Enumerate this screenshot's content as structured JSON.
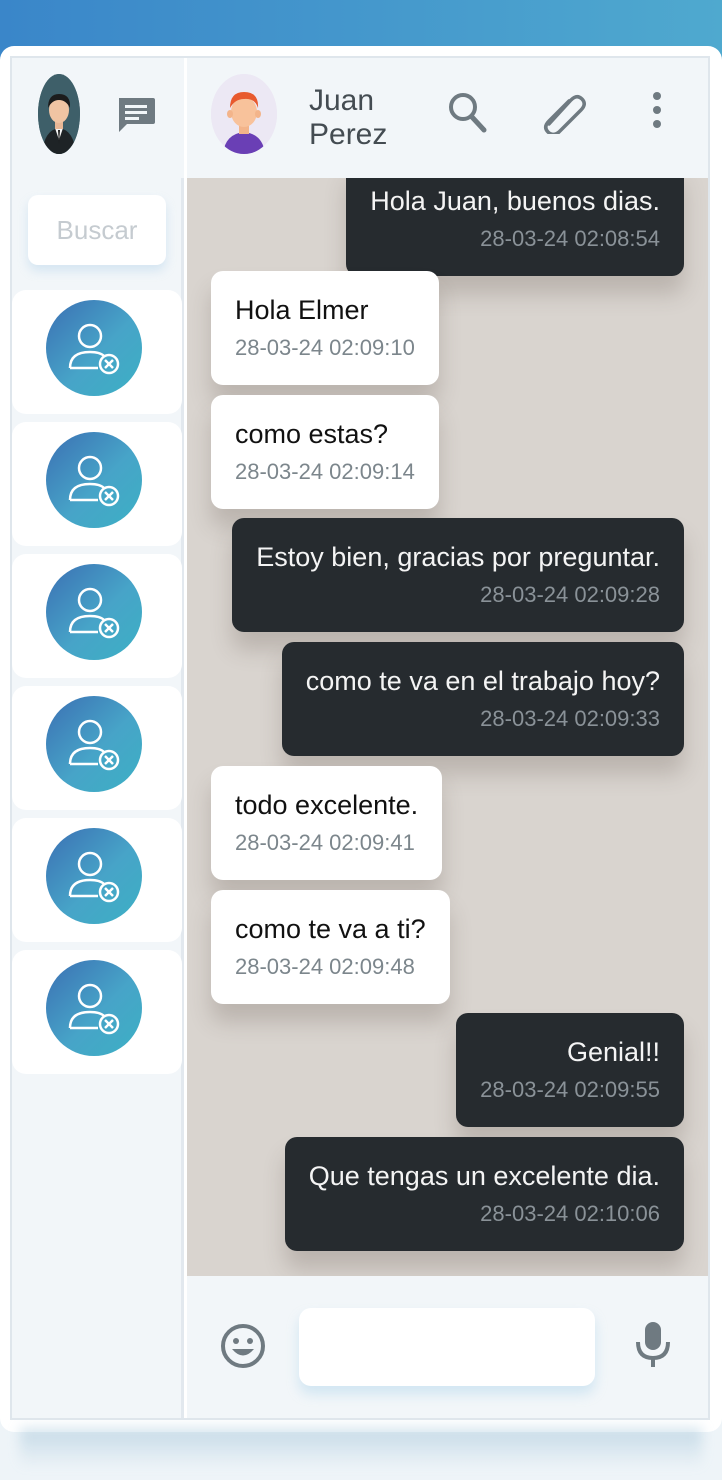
{
  "sidebar": {
    "search_placeholder": "Buscar",
    "icons": {
      "profile": "user-avatar",
      "new_chat": "chat-bubble-icon",
      "contact": "user-removed-icon"
    },
    "contacts": [
      {
        "avatar": "user-removed-icon"
      },
      {
        "avatar": "user-removed-icon"
      },
      {
        "avatar": "user-removed-icon"
      },
      {
        "avatar": "user-removed-icon"
      },
      {
        "avatar": "user-removed-icon"
      },
      {
        "avatar": "user-removed-icon"
      }
    ]
  },
  "header": {
    "name": "Juan Perez",
    "icons": [
      "search-icon",
      "paperclip-icon",
      "more-vertical-icon"
    ]
  },
  "messages": [
    {
      "text": "Hola Juan, buenos dias.",
      "time": "28-03-24 02:08:54",
      "direction": "out"
    },
    {
      "text": "Hola Elmer",
      "time": "28-03-24 02:09:10",
      "direction": "in"
    },
    {
      "text": "como estas?",
      "time": "28-03-24 02:09:14",
      "direction": "in"
    },
    {
      "text": "Estoy bien, gracias por preguntar.",
      "time": "28-03-24 02:09:28",
      "direction": "out"
    },
    {
      "text": "como te va en el trabajo hoy?",
      "time": "28-03-24 02:09:33",
      "direction": "out"
    },
    {
      "text": "todo excelente.",
      "time": "28-03-24 02:09:41",
      "direction": "in"
    },
    {
      "text": "como te va a ti?",
      "time": "28-03-24 02:09:48",
      "direction": "in"
    },
    {
      "text": "Genial!!",
      "time": "28-03-24 02:09:55",
      "direction": "out"
    },
    {
      "text": "Que tengas un excelente dia.",
      "time": "28-03-24 02:10:06",
      "direction": "out"
    }
  ],
  "footer": {
    "input_value": "",
    "icons": [
      "emoji-icon",
      "microphone-icon"
    ]
  },
  "colors": {
    "incoming_bubble": "#ffffff",
    "outgoing_bubble": "#262b2f",
    "chat_background": "#d9d4cf",
    "accent": "#47a4c8"
  }
}
